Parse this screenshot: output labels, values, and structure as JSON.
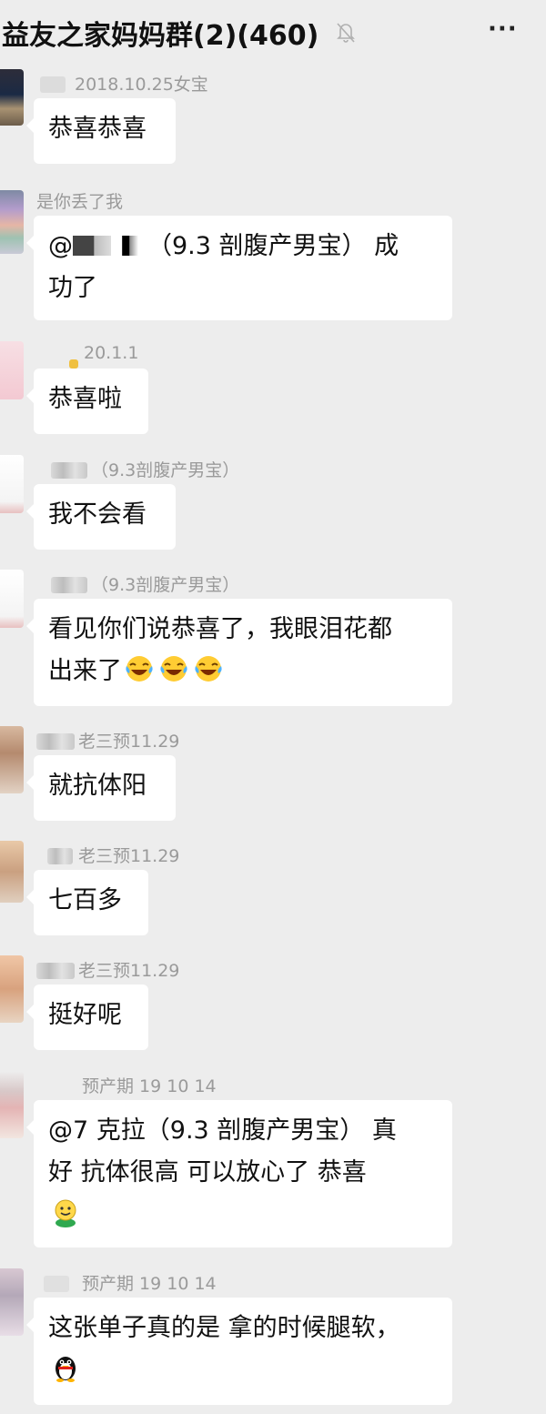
{
  "header": {
    "title": "益友之家妈妈群(2)(460)",
    "more_label": "···",
    "mute_icon": "bell-off-icon"
  },
  "messages": [
    {
      "sender": "2018.10.25女宝",
      "lines": [
        "恭喜恭喜"
      ]
    },
    {
      "sender": "是你丢了我",
      "line1_text": "（9.3 剖腹产男宝） 成",
      "line2_text": "功了"
    },
    {
      "sender": "20.1.1",
      "lines": [
        "恭喜啦"
      ]
    },
    {
      "sender": "（9.3剖腹产男宝）",
      "lines": [
        "我不会看"
      ]
    },
    {
      "sender": "（9.3剖腹产男宝）",
      "line1_text": "看见你们说恭喜了，我眼泪花都",
      "line2_text": "出来了",
      "emoji": "laugh-cry-icon"
    },
    {
      "sender": "老三预11.29",
      "lines": [
        "就抗体阳"
      ]
    },
    {
      "sender": "老三预11.29",
      "lines": [
        "七百多"
      ]
    },
    {
      "sender": "老三预11.29",
      "lines": [
        "挺好呢"
      ]
    },
    {
      "sender": "预产期 19 10 14",
      "line1_text": "@7 克拉（9.3 剖腹产男宝） 真",
      "line2_text": "好  抗体很高  可以放心了  恭喜",
      "emoji": "smiley-icon"
    },
    {
      "sender": "预产期 19 10 14",
      "line1_text": "这张单子真的是 拿的时候腿软，",
      "emoji": "penguin-icon"
    }
  ]
}
